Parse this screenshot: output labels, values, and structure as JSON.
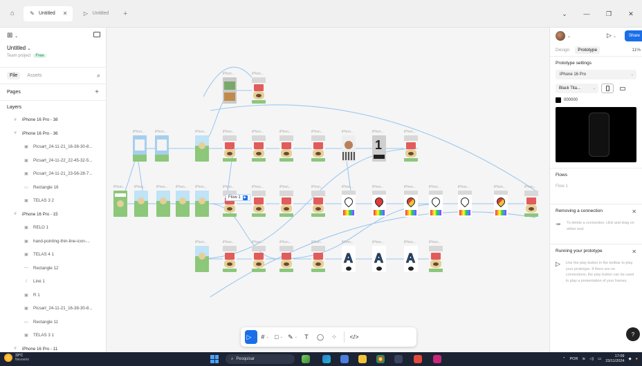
{
  "titlebar": {
    "tabs": [
      {
        "label": "Untitled",
        "active": true
      },
      {
        "label": "Untitled",
        "active": false
      }
    ],
    "new_tab_icon": "+"
  },
  "left_panel": {
    "menu_icon": "figma-menu",
    "file_title": "Untitled",
    "team_project": "Team project",
    "plan_badge": "Free",
    "tabs": {
      "file": "File",
      "assets": "Assets"
    },
    "pages_label": "Pages",
    "layers_label": "Layers",
    "layers": [
      {
        "name": "iPhone 16 Pro - 38",
        "level": 0,
        "icon": "#"
      },
      {
        "name": "iPhone 16 Pro - 36",
        "level": 0,
        "icon": "#"
      },
      {
        "name": "Picsart_24-11-21_16-38-30-8...",
        "level": 1,
        "icon": "▣"
      },
      {
        "name": "Picsart_24-11-22_22-45-32-5...",
        "level": 1,
        "icon": "▣"
      },
      {
        "name": "Picsart_24-11-21_23-56-28-7...",
        "level": 1,
        "icon": "▣"
      },
      {
        "name": "Rectangle 16",
        "level": 1,
        "icon": "▭"
      },
      {
        "name": "TELAS 3 2",
        "level": 1,
        "icon": "▣"
      },
      {
        "name": "iPhone 16 Pro - 15",
        "level": 0,
        "icon": "#"
      },
      {
        "name": "RELO 1",
        "level": 1,
        "icon": "▣"
      },
      {
        "name": "hand-pointing-thin-line-icon-...",
        "level": 1,
        "icon": "▣"
      },
      {
        "name": "TELAS 4 1",
        "level": 1,
        "icon": "▣"
      },
      {
        "name": "Rectangle 12",
        "level": 1,
        "icon": "—"
      },
      {
        "name": "Line 1",
        "level": 1,
        "icon": "/"
      },
      {
        "name": "R 1",
        "level": 1,
        "icon": "▣"
      },
      {
        "name": "Picsart_24-11-21_16-38-30-8...",
        "level": 1,
        "icon": "▣"
      },
      {
        "name": "Rectangle 11",
        "level": 1,
        "icon": "▭"
      },
      {
        "name": "TELAS 3 1",
        "level": 1,
        "icon": "▣"
      },
      {
        "name": "iPhone 16 Pro - 11",
        "level": 0,
        "icon": "#"
      }
    ]
  },
  "canvas": {
    "frame_label": "iPhon...",
    "flow_tag": "Flow 1"
  },
  "toolbar": {
    "tools": [
      {
        "name": "move-tool",
        "glyph": "▷",
        "active": true,
        "chevron": true
      },
      {
        "name": "frame-tool",
        "glyph": "#",
        "active": false,
        "chevron": true
      },
      {
        "name": "shape-tool",
        "glyph": "□",
        "active": false,
        "chevron": true
      },
      {
        "name": "pen-tool",
        "glyph": "✎",
        "active": false,
        "chevron": true
      },
      {
        "name": "text-tool",
        "glyph": "T",
        "active": false,
        "chevron": false
      },
      {
        "name": "comment-tool",
        "glyph": "◯",
        "active": false,
        "chevron": false
      },
      {
        "name": "actions-tool",
        "glyph": "⁘",
        "active": false,
        "chevron": false
      },
      {
        "name": "dev-mode-toggle",
        "glyph": "</>",
        "active": false,
        "chevron": false
      }
    ]
  },
  "right_panel": {
    "share_label": "Share",
    "tabs": {
      "design": "Design",
      "prototype": "Prototype"
    },
    "zoom": "11%",
    "prototype_settings": "Prototype settings",
    "device": "iPhone 16 Pro",
    "device_color": "Black Tita...",
    "background_hex": "000000",
    "flows_label": "Flows",
    "flow_item": "Flow 1",
    "removing_title": "Removing a connection",
    "removing_text": "To delete a connection, click and drag on either end.",
    "running_title": "Running your prototype",
    "running_text": "Use the play button in the toolbar to play your prototype. If there are no connections, the play button can be used to play a presentation of your frames.",
    "help": "?"
  },
  "taskbar": {
    "temperature": "33°C",
    "weather": "Nevoeiro",
    "search": "Pesquisar",
    "lang": "POR",
    "time": "17:09",
    "date": "23/11/2024"
  },
  "colors": {
    "accent": "#1a6fe8",
    "connection": "#9cc8ef",
    "frame_green": "#8cc77a",
    "dog_tan": "#e6cf98"
  }
}
